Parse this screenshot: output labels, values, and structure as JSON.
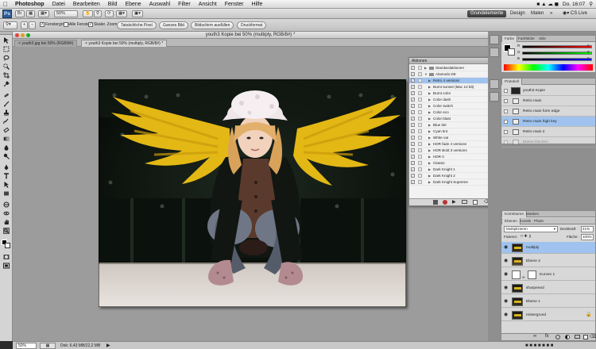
{
  "menubar": {
    "app": "Photoshop",
    "items": [
      "Datei",
      "Bearbeiten",
      "Bild",
      "Ebene",
      "Auswahl",
      "Filter",
      "Ansicht",
      "Fenster",
      "Hilfe"
    ],
    "clock": "Do. 16:07"
  },
  "appbar": {
    "logo": "Ps",
    "zoom": "50%",
    "workspaces": [
      "Grundelemente",
      "Design",
      "Malen"
    ],
    "cs_live": "CS Live"
  },
  "options": {
    "checks": [
      "Fenstergröße",
      "Alle Fenster",
      "Skaler. Zoom"
    ],
    "buttons": [
      "Tatsächliche Pixel",
      "Ganzes Bild",
      "Bildschirm ausfüllen",
      "Druckformat"
    ]
  },
  "document": {
    "title": "youth3 Kopie bei 50% (multiply, RGB/8#) *",
    "tabs": [
      "youth3.jpg bei 50% (RGB/8#)",
      "youth3 Kopie bei 50% (multiply, RGB/8#) *"
    ]
  },
  "actions": {
    "title": "Aktionen",
    "rows": [
      {
        "label": "Standardaktionen",
        "type": "set"
      },
      {
        "label": "Alamodo DE",
        "type": "set"
      },
      {
        "label": "Retro 4 versions",
        "type": "action"
      },
      {
        "label": "Burnt sunset (Mac 12 bit)",
        "type": "action"
      },
      {
        "label": "Burnt color",
        "type": "action"
      },
      {
        "label": "Color dash",
        "type": "action"
      },
      {
        "label": "Color switch",
        "type": "action"
      },
      {
        "label": "Color eco",
        "type": "action"
      },
      {
        "label": "Color blast",
        "type": "action"
      },
      {
        "label": "Blue tint",
        "type": "action"
      },
      {
        "label": "Cyan tint",
        "type": "action"
      },
      {
        "label": "White out",
        "type": "action"
      },
      {
        "label": "HDR fade 4 versions",
        "type": "action"
      },
      {
        "label": "HDR Bold 3 versions",
        "type": "action"
      },
      {
        "label": "HDR II",
        "type": "action"
      },
      {
        "label": "Classic",
        "type": "action"
      },
      {
        "label": "Dark Knight 1",
        "type": "action"
      },
      {
        "label": "Dark Knight 2",
        "type": "action"
      },
      {
        "label": "Dark Knight Supreme",
        "type": "action"
      }
    ]
  },
  "color_panel": {
    "tabs": [
      "Farbe",
      "Farbfelder",
      "Stile"
    ],
    "slider_labels": [
      "R",
      "G",
      "B"
    ],
    "values": [
      "0",
      "0",
      "0"
    ]
  },
  "history": {
    "title": "Protokoll",
    "rows": [
      "youth3 Kopie",
      "Retro main",
      "Retro main form edge",
      "Retro main high key",
      "Retro main 2",
      "Ebene löschen"
    ],
    "selected": 3
  },
  "layers": {
    "tabs": [
      "Korrekturen",
      "Masken"
    ],
    "subtabs": [
      "Ebenen",
      "Kanäle",
      "Pfade"
    ],
    "blend_mode": "Multiplizieren",
    "opacity_label": "Deckkraft:",
    "opacity": "41%",
    "lock_label": "Fixieren:",
    "fill_label": "Fläche:",
    "fill": "100%",
    "rows": [
      "multiply",
      "Ebene 2",
      "Kurven 1",
      "sharpened",
      "Ebene 1",
      "Hintergrund"
    ],
    "selected": 0
  },
  "statusbar": {
    "zoom": "50%",
    "doc": "Dok: 6,43 MB/22,2 MB"
  }
}
